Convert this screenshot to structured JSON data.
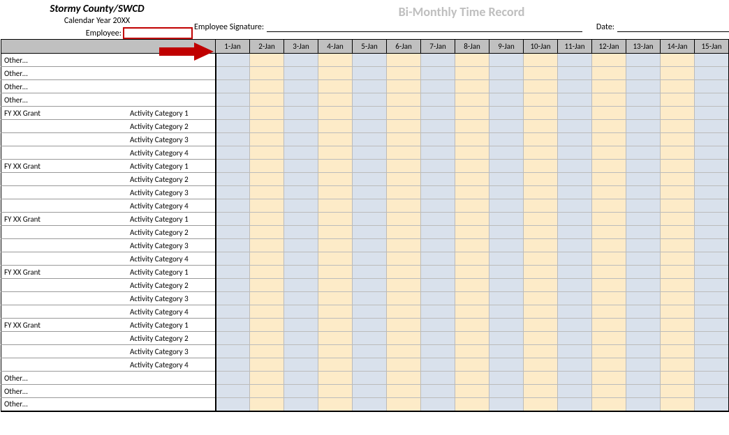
{
  "header": {
    "title_main": "Stormy County/SWCD",
    "calendar_year": "Calendar Year 20XX",
    "title_record": "Bi-Monthly Time Record",
    "sig_label": "Employee Signature:",
    "date_label": "Date:",
    "emp_label": "Employee:"
  },
  "dates": [
    "1-Jan",
    "2-Jan",
    "3-Jan",
    "4-Jan",
    "5-Jan",
    "6-Jan",
    "7-Jan",
    "8-Jan",
    "9-Jan",
    "10-Jan",
    "11-Jan",
    "12-Jan",
    "13-Jan",
    "14-Jan",
    "15-Jan"
  ],
  "rows": [
    {
      "col1": "Other…",
      "col2": ""
    },
    {
      "col1": "Other…",
      "col2": ""
    },
    {
      "col1": "Other…",
      "col2": ""
    },
    {
      "col1": "Other…",
      "col2": ""
    },
    {
      "col1": "FY XX Grant",
      "col2": "Activity Category 1"
    },
    {
      "col1": "",
      "col2": "Activity Category 2"
    },
    {
      "col1": "",
      "col2": "Activity Category 3"
    },
    {
      "col1": "",
      "col2": "Activity Category 4"
    },
    {
      "col1": "FY XX Grant",
      "col2": "Activity Category 1"
    },
    {
      "col1": "",
      "col2": "Activity Category 2"
    },
    {
      "col1": "",
      "col2": "Activity Category 3"
    },
    {
      "col1": "",
      "col2": "Activity Category 4"
    },
    {
      "col1": "FY XX Grant",
      "col2": "Activity Category 1"
    },
    {
      "col1": "",
      "col2": "Activity Category 2"
    },
    {
      "col1": "",
      "col2": "Activity Category 3"
    },
    {
      "col1": "",
      "col2": "Activity Category 4"
    },
    {
      "col1": "FY XX Grant",
      "col2": "Activity Category 1"
    },
    {
      "col1": "",
      "col2": "Activity Category 2"
    },
    {
      "col1": "",
      "col2": "Activity Category 3"
    },
    {
      "col1": "",
      "col2": "Activity Category 4"
    },
    {
      "col1": "FY XX Grant",
      "col2": "Activity Category 1"
    },
    {
      "col1": "",
      "col2": "Activity Category 2"
    },
    {
      "col1": "",
      "col2": "Activity Category 3"
    },
    {
      "col1": "",
      "col2": "Activity Category 4"
    },
    {
      "col1": "Other…",
      "col2": ""
    },
    {
      "col1": "Other…",
      "col2": ""
    },
    {
      "col1": "Other…",
      "col2": ""
    }
  ]
}
